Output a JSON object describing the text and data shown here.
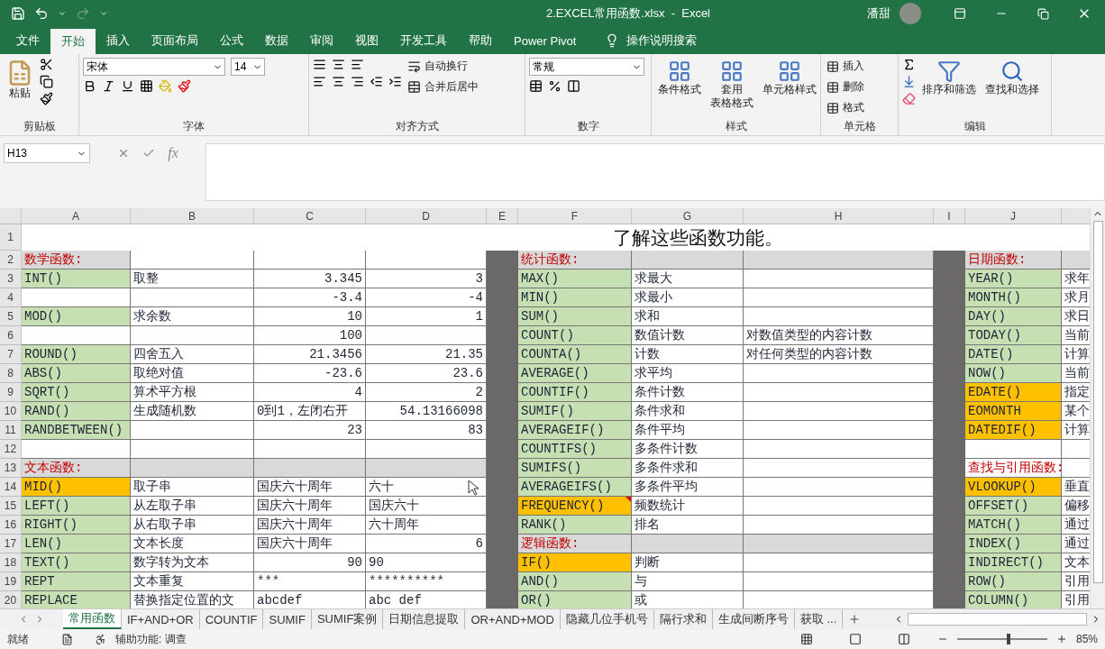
{
  "window": {
    "title": "2.EXCEL常用函数.xlsx  -  Excel",
    "user": "潘甜"
  },
  "menu_tabs": [
    {
      "label": "文件",
      "selected": false
    },
    {
      "label": "开始",
      "selected": true
    },
    {
      "label": "插入",
      "selected": false
    },
    {
      "label": "页面布局",
      "selected": false
    },
    {
      "label": "公式",
      "selected": false
    },
    {
      "label": "数据",
      "selected": false
    },
    {
      "label": "审阅",
      "selected": false
    },
    {
      "label": "视图",
      "selected": false
    },
    {
      "label": "开发工具",
      "selected": false
    },
    {
      "label": "帮助",
      "selected": false
    },
    {
      "label": "Power Pivot",
      "selected": false
    }
  ],
  "tell_me": "操作说明搜索",
  "ribbon": {
    "clipboard": {
      "label": "剪贴板",
      "paste": "粘贴"
    },
    "font": {
      "label": "字体",
      "font_name": "宋体",
      "font_size": "14"
    },
    "alignment": {
      "label": "对齐方式",
      "wrap": "自动换行",
      "merge": "合并后居中"
    },
    "number": {
      "label": "数字",
      "format": "常规"
    },
    "styles": {
      "label": "样式",
      "buttons": [
        {
          "lines": [
            "条件格式"
          ]
        },
        {
          "lines": [
            "套用",
            "表格格式"
          ]
        },
        {
          "lines": [
            "单元格样式"
          ]
        }
      ]
    },
    "cells": {
      "label": "单元格",
      "buttons": [
        "插入",
        "删除",
        "格式"
      ]
    },
    "editing": {
      "label": "编辑",
      "buttons": [
        "排序和筛选",
        "查找和选择"
      ]
    }
  },
  "name_box": "H13",
  "function_label": "fx",
  "columns": [
    "A",
    "B",
    "C",
    "D",
    "E",
    "F",
    "G",
    "H",
    "I",
    "J"
  ],
  "rows": [
    {
      "number": "1",
      "title": "了解这些函数功能。"
    },
    {
      "number": "2",
      "a": {
        "text": "数学函数:",
        "kind": "heading",
        "color": "#d9d9d9"
      },
      "f": {
        "text": "统计函数:",
        "kind": "heading",
        "color": "#d9d9d9"
      },
      "g": {
        "color": "#d9d9d9"
      },
      "h": {
        "color": "#d9d9d9"
      },
      "j": {
        "text": "日期函数:",
        "kind": "heading",
        "color": "#d9d9d9"
      },
      "k": {
        "color": "#d9d9d9"
      }
    },
    {
      "number": "3",
      "a": {
        "text": "INT()",
        "color": "#c6e0b4"
      },
      "b": {
        "text": "取整"
      },
      "c": {
        "text": "3.345",
        "kind": "number"
      },
      "d": {
        "text": "3",
        "kind": "number"
      },
      "f": {
        "text": "MAX()",
        "color": "#c6e0b4"
      },
      "g": {
        "text": "求最大"
      },
      "j": {
        "text": "YEAR()",
        "color": "#c6e0b4"
      },
      "k": {
        "text": "求年"
      }
    },
    {
      "number": "4",
      "c": {
        "text": "-3.4",
        "kind": "number"
      },
      "d": {
        "text": "-4",
        "kind": "number"
      },
      "f": {
        "text": "MIN()",
        "color": "#c6e0b4"
      },
      "g": {
        "text": "求最小"
      },
      "j": {
        "text": "MONTH()",
        "color": "#c6e0b4"
      },
      "k": {
        "text": "求月"
      }
    },
    {
      "number": "5",
      "a": {
        "text": "MOD()",
        "color": "#c6e0b4"
      },
      "b": {
        "text": "求余数"
      },
      "c": {
        "text": "10",
        "kind": "number"
      },
      "d": {
        "text": "1",
        "kind": "number"
      },
      "f": {
        "text": "SUM()",
        "color": "#c6e0b4"
      },
      "g": {
        "text": "求和"
      },
      "j": {
        "text": "DAY()",
        "color": "#c6e0b4"
      },
      "k": {
        "text": "求日"
      }
    },
    {
      "number": "6",
      "c": {
        "text": "100",
        "kind": "number"
      },
      "f": {
        "text": "COUNT()",
        "color": "#c6e0b4"
      },
      "g": {
        "text": "数值计数"
      },
      "h": {
        "text": "对数值类型的内容计数"
      },
      "j": {
        "text": "TODAY()",
        "color": "#c6e0b4"
      },
      "k": {
        "text": "当前"
      }
    },
    {
      "number": "7",
      "a": {
        "text": "ROUND()",
        "color": "#c6e0b4"
      },
      "b": {
        "text": "四舍五入"
      },
      "c": {
        "text": "21.3456",
        "kind": "number"
      },
      "d": {
        "text": "21.35",
        "kind": "number"
      },
      "f": {
        "text": "COUNTA()",
        "color": "#c6e0b4"
      },
      "g": {
        "text": "计数"
      },
      "h": {
        "text": "对任何类型的内容计数"
      },
      "j": {
        "text": "DATE()",
        "color": "#c6e0b4"
      },
      "k": {
        "text": "计算"
      }
    },
    {
      "number": "8",
      "a": {
        "text": "ABS()",
        "color": "#c6e0b4"
      },
      "b": {
        "text": "取绝对值"
      },
      "c": {
        "text": "-23.6",
        "kind": "number"
      },
      "d": {
        "text": "23.6",
        "kind": "number"
      },
      "f": {
        "text": "AVERAGE()",
        "color": "#c6e0b4"
      },
      "g": {
        "text": "求平均"
      },
      "j": {
        "text": "NOW()",
        "color": "#c6e0b4"
      },
      "k": {
        "text": "当前"
      }
    },
    {
      "number": "9",
      "a": {
        "text": "SQRT()",
        "color": "#c6e0b4"
      },
      "b": {
        "text": "算术平方根"
      },
      "c": {
        "text": "4",
        "kind": "number"
      },
      "d": {
        "text": "2",
        "kind": "number"
      },
      "f": {
        "text": "COUNTIF()",
        "color": "#c6e0b4"
      },
      "g": {
        "text": "条件计数"
      },
      "j": {
        "text": "EDATE()",
        "color": "#ffc000"
      },
      "k": {
        "text": "指定"
      }
    },
    {
      "number": "10",
      "a": {
        "text": "RAND()",
        "color": "#c6e0b4"
      },
      "b": {
        "text": "生成随机数"
      },
      "c": {
        "text": "0到1，左闭右开"
      },
      "d": {
        "text": "54.13166098",
        "kind": "number"
      },
      "f": {
        "text": "SUMIF()",
        "color": "#c6e0b4"
      },
      "g": {
        "text": "条件求和"
      },
      "j": {
        "text": "EOMONTH",
        "color": "#ffc000"
      },
      "k": {
        "text": "某个"
      }
    },
    {
      "number": "11",
      "a": {
        "text": "RANDBETWEEN()",
        "color": "#c6e0b4"
      },
      "c": {
        "text": "23",
        "kind": "number"
      },
      "d": {
        "text": "83",
        "kind": "number"
      },
      "f": {
        "text": "AVERAGEIF()",
        "color": "#c6e0b4"
      },
      "g": {
        "text": "条件平均"
      },
      "j": {
        "text": "DATEDIF()",
        "color": "#ffc000"
      },
      "k": {
        "text": "计算"
      }
    },
    {
      "number": "12",
      "f": {
        "text": "COUNTIFS()",
        "color": "#c6e0b4"
      },
      "g": {
        "text": "多条件计数"
      }
    },
    {
      "number": "13",
      "a": {
        "text": "文本函数:",
        "kind": "heading",
        "color": "#d9d9d9"
      },
      "b": {
        "color": "#d9d9d9"
      },
      "c": {
        "color": "#d9d9d9"
      },
      "d": {
        "color": "#d9d9d9"
      },
      "f": {
        "text": "SUMIFS()",
        "color": "#c6e0b4"
      },
      "g": {
        "text": "多条件求和"
      },
      "j": {
        "text": "查找与引用函数:",
        "kind": "heading"
      }
    },
    {
      "number": "14",
      "a": {
        "text": "MID()",
        "color": "#ffc000"
      },
      "b": {
        "text": "取子串"
      },
      "c": {
        "text": "国庆六十周年"
      },
      "d": {
        "text": "六十"
      },
      "f": {
        "text": "AVERAGEIFS()",
        "color": "#c6e0b4"
      },
      "g": {
        "text": "多条件平均"
      },
      "j": {
        "text": "VLOOKUP()",
        "color": "#ffc000"
      },
      "k": {
        "text": "垂直"
      }
    },
    {
      "number": "15",
      "a": {
        "text": "LEFT()",
        "color": "#c6e0b4"
      },
      "b": {
        "text": "从左取子串"
      },
      "c": {
        "text": "国庆六十周年"
      },
      "d": {
        "text": "国庆六十"
      },
      "f": {
        "text": "FREQUENCY()",
        "color": "#ffc000",
        "note": true
      },
      "g": {
        "text": "频数统计"
      },
      "j": {
        "text": "OFFSET()",
        "color": "#c6e0b4"
      },
      "k": {
        "text": "偏移"
      }
    },
    {
      "number": "16",
      "a": {
        "text": "RIGHT()",
        "color": "#c6e0b4"
      },
      "b": {
        "text": "从右取子串"
      },
      "c": {
        "text": "国庆六十周年"
      },
      "d": {
        "text": "六十周年"
      },
      "f": {
        "text": "RANK()",
        "color": "#c6e0b4"
      },
      "g": {
        "text": "排名"
      },
      "j": {
        "text": "MATCH()",
        "color": "#c6e0b4"
      },
      "k": {
        "text": "通过"
      }
    },
    {
      "number": "17",
      "a": {
        "text": "LEN()",
        "color": "#c6e0b4"
      },
      "b": {
        "text": "文本长度"
      },
      "c": {
        "text": "国庆六十周年"
      },
      "d": {
        "text": "6",
        "kind": "number"
      },
      "f": {
        "text": "逻辑函数:",
        "kind": "heading",
        "color": "#d9d9d9"
      },
      "g": {
        "color": "#d9d9d9"
      },
      "h": {
        "color": "#d9d9d9"
      },
      "j": {
        "text": "INDEX()",
        "color": "#c6e0b4"
      },
      "k": {
        "text": "通过"
      }
    },
    {
      "number": "18",
      "a": {
        "text": "TEXT()",
        "color": "#c6e0b4"
      },
      "b": {
        "text": "数字转为文本"
      },
      "c": {
        "text": "90",
        "kind": "number"
      },
      "d": {
        "text": "90"
      },
      "f": {
        "text": "IF()",
        "color": "#ffc000"
      },
      "g": {
        "text": "判断"
      },
      "j": {
        "text": "INDIRECT()",
        "color": "#c6e0b4"
      },
      "k": {
        "text": "文本"
      }
    },
    {
      "number": "19",
      "a": {
        "text": "REPT",
        "color": "#c6e0b4"
      },
      "b": {
        "text": "文本重复"
      },
      "c": {
        "text": "***"
      },
      "d": {
        "text": "**********"
      },
      "f": {
        "text": "AND()",
        "color": "#c6e0b4"
      },
      "g": {
        "text": "与"
      },
      "j": {
        "text": "ROW()",
        "color": "#c6e0b4"
      },
      "k": {
        "text": "引用"
      }
    },
    {
      "number": "20",
      "a": {
        "text": "REPLACE",
        "color": "#c6e0b4"
      },
      "b": {
        "text": "替换指定位置的文"
      },
      "c": {
        "text": "abcdef"
      },
      "d": {
        "text": "abc def"
      },
      "f": {
        "text": "OR()",
        "color": "#c6e0b4"
      },
      "g": {
        "text": "或"
      },
      "j": {
        "text": "COLUMN()",
        "color": "#c6e0b4"
      },
      "k": {
        "text": "引用"
      }
    }
  ],
  "sheet_tabs": [
    {
      "label": "常用函数",
      "selected": true
    },
    {
      "label": "IF+AND+OR",
      "selected": false
    },
    {
      "label": "COUNTIF",
      "selected": false
    },
    {
      "label": "SUMIF",
      "selected": false
    },
    {
      "label": "SUMIF案例",
      "selected": false
    },
    {
      "label": "日期信息提取",
      "selected": false
    },
    {
      "label": "OR+AND+MOD",
      "selected": false
    },
    {
      "label": "隐藏几位手机号",
      "selected": false
    },
    {
      "label": "隔行求和",
      "selected": false
    },
    {
      "label": "生成间断序号",
      "selected": false
    },
    {
      "label": "获取 ...",
      "selected": false
    }
  ],
  "status_bar": {
    "mode": "就绪",
    "accessibility": "辅助功能: 调查",
    "zoom": "85%",
    "zoom_level": {
      "level": 0.55
    }
  }
}
